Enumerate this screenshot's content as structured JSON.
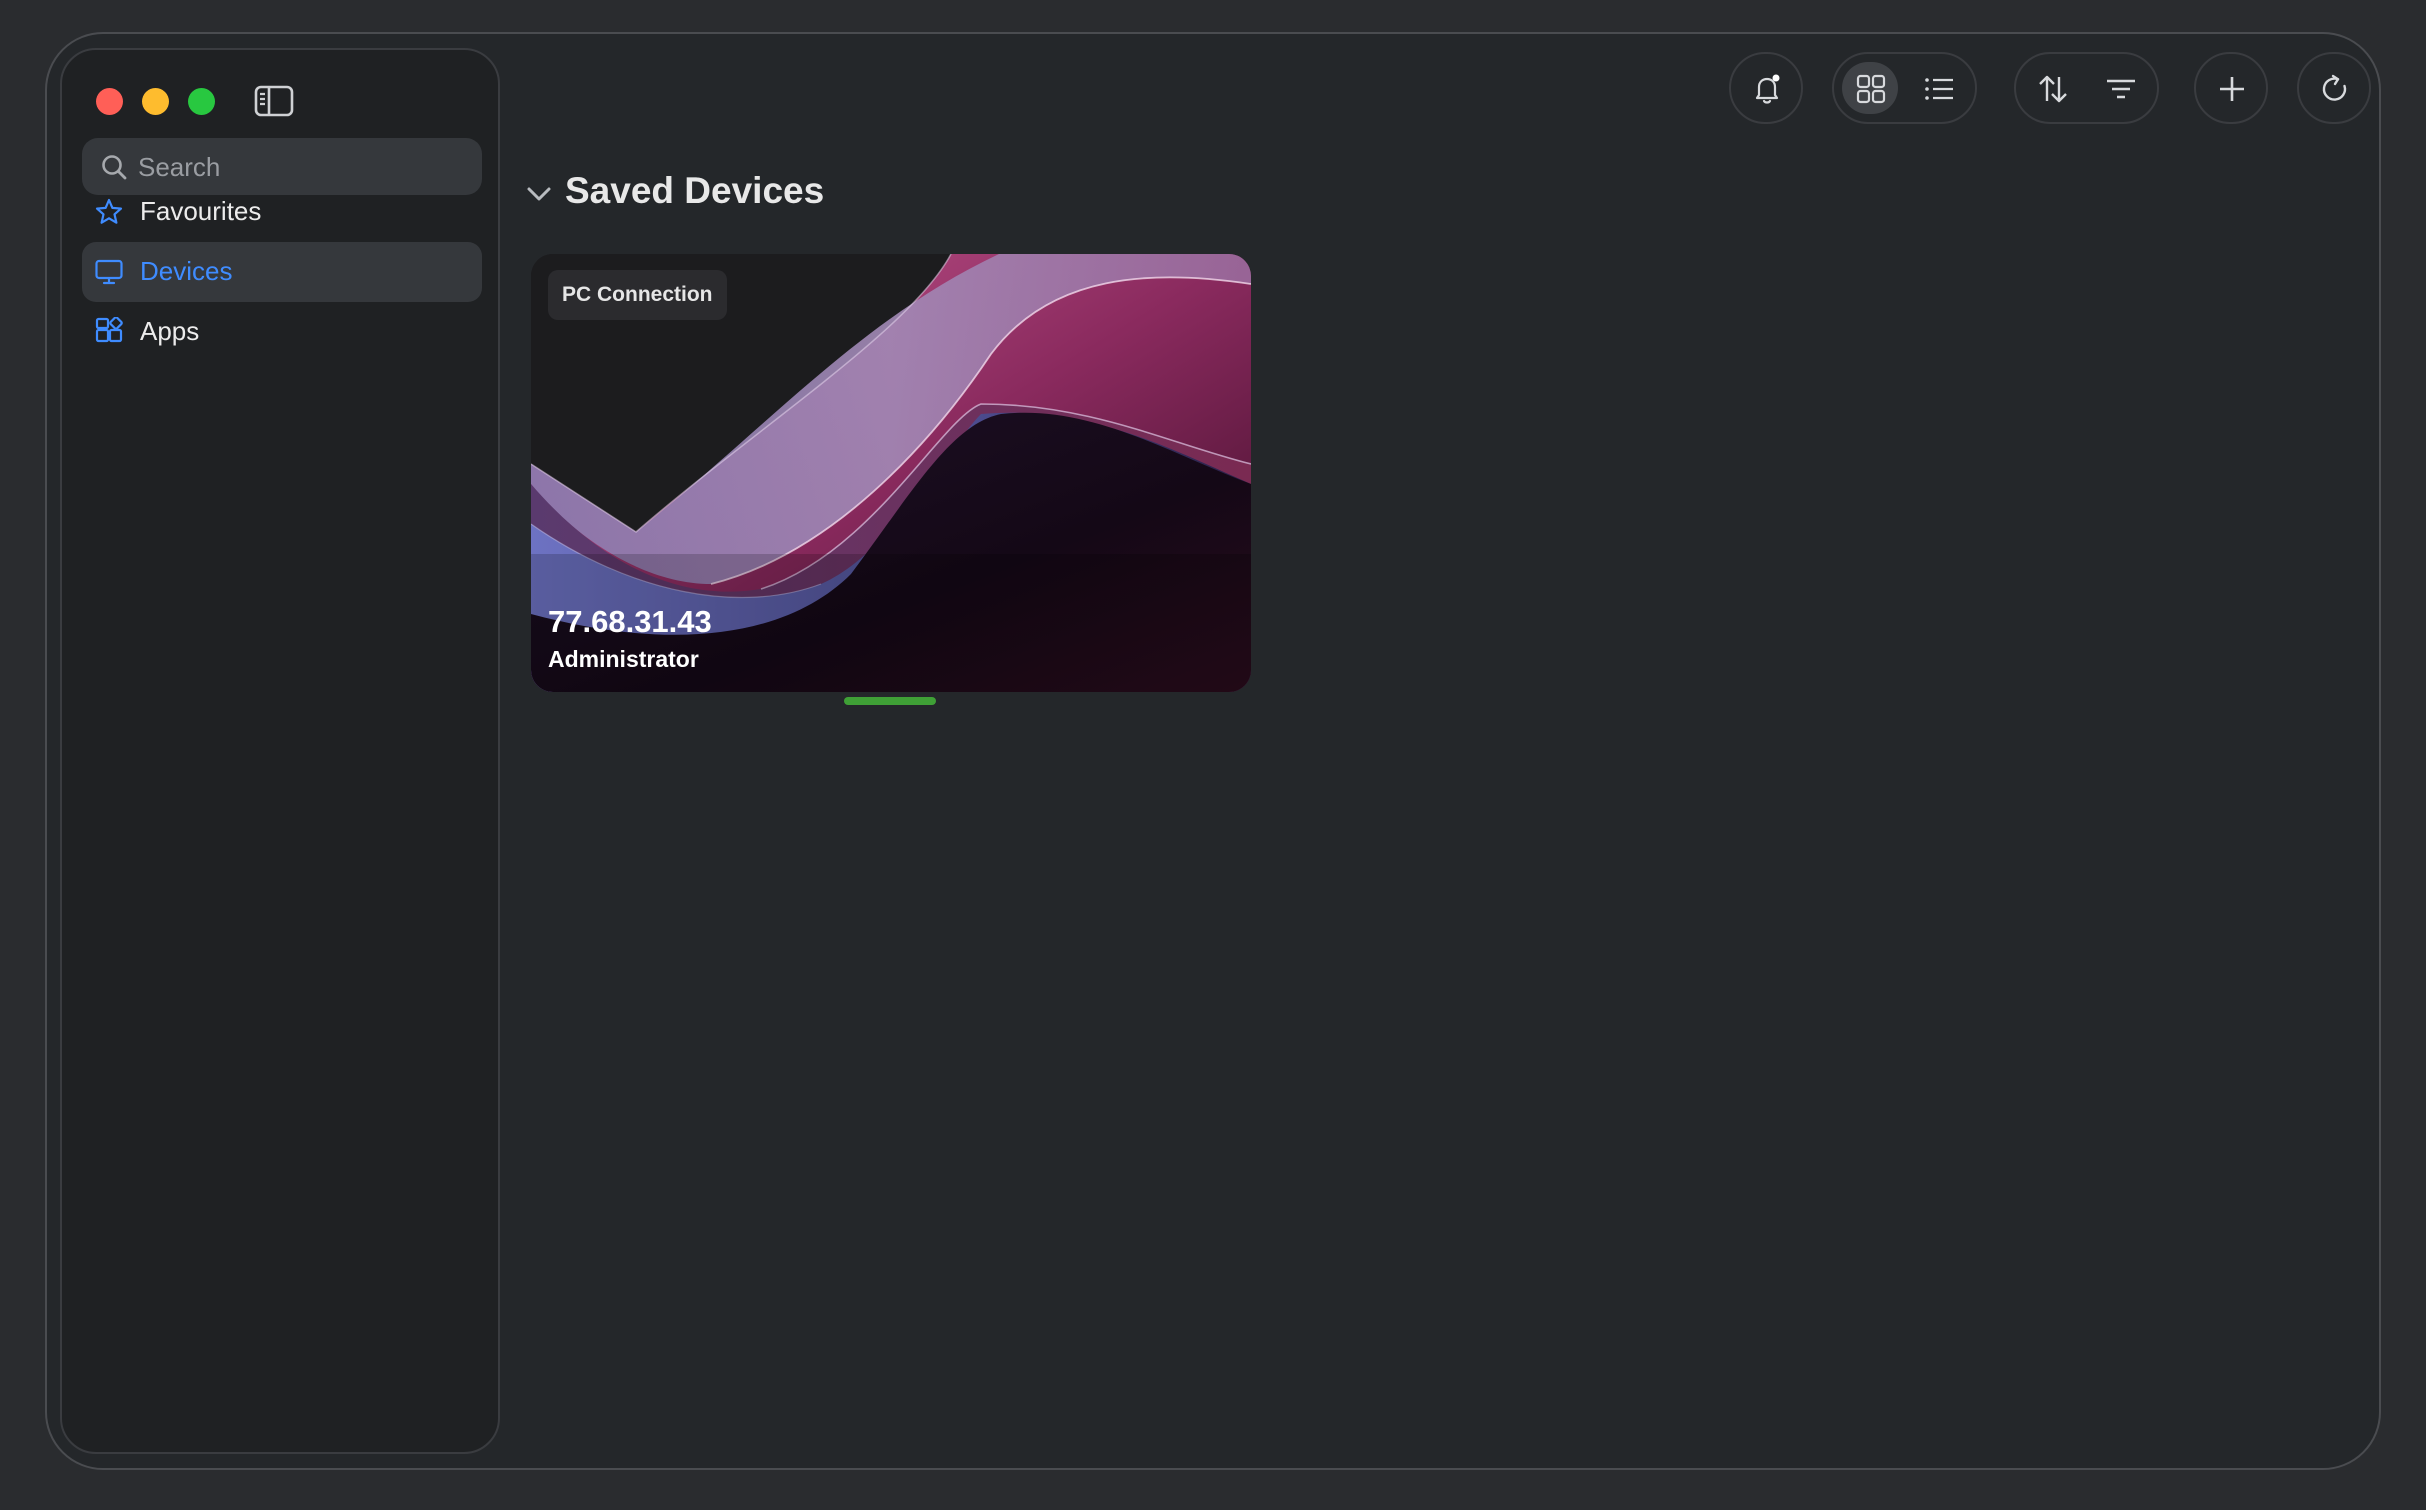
{
  "window": {
    "traffic_lights": [
      "close",
      "minimize",
      "maximize"
    ]
  },
  "sidebar": {
    "toggle_icon": "sidebar-icon",
    "search": {
      "placeholder": "Search",
      "value": ""
    },
    "items": [
      {
        "label": "Favourites",
        "icon": "star-icon",
        "active": false
      },
      {
        "label": "Devices",
        "icon": "monitor-icon",
        "active": true
      },
      {
        "label": "Apps",
        "icon": "apps-icon",
        "active": false
      }
    ]
  },
  "toolbar": {
    "notifications_icon": "bell-icon",
    "view_modes": [
      {
        "icon": "grid-icon",
        "selected": true
      },
      {
        "icon": "list-icon",
        "selected": false
      }
    ],
    "sort_icon": "sort-icon",
    "filter_icon": "filter-icon",
    "add_icon": "plus-icon",
    "refresh_icon": "refresh-icon"
  },
  "main": {
    "section_title": "Saved Devices",
    "devices": [
      {
        "tag": "PC Connection",
        "address": "77.68.31.43",
        "user": "Administrator",
        "status_color": "#3fa036"
      }
    ]
  },
  "colors": {
    "accent": "#3f8cff",
    "status_online": "#3fa036"
  }
}
